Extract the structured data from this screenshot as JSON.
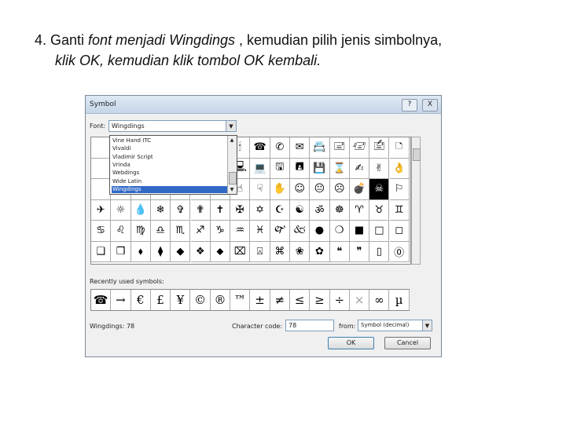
{
  "caption": {
    "line1_prefix": "4. Ganti ",
    "line1_em": "font menjadi Wingdings",
    "line1_suffix": " , kemudian pilih jenis simbolnya,",
    "line2": "klik OK, kemudian klik tombol OK kembali."
  },
  "dialog": {
    "title": "Symbol",
    "help_label": "?",
    "close_label": "X",
    "font_label": "Font:",
    "font_value": "Wingdings",
    "font_list": [
      "Vine Hand ITC",
      "Vivaldi",
      "Vladimir Script",
      "Vrinda",
      "Webdings",
      "Wide Latin",
      "Wingdings"
    ],
    "font_selected_index": 6,
    "symbol_rows": [
      [
        "",
        "",
        "✂",
        "✁",
        "👓",
        "🔔",
        "📖",
        "🕯",
        "☎",
        "✆",
        "✉",
        "📇",
        "🖃",
        "🖅",
        "🖆",
        "🗅"
      ],
      [
        "",
        "",
        "",
        "⏳",
        "⌨",
        "🖱",
        "🖲",
        "🖳",
        "💻",
        "🖫",
        "🖪",
        "💾",
        "⌛",
        "✍",
        "✌",
        "👌"
      ],
      [
        "",
        "",
        "",
        "👍",
        "👎",
        "☜",
        "☞",
        "☝",
        "☟",
        "✋",
        "☺",
        "😐",
        "☹",
        "💣",
        "☠",
        "⚐"
      ],
      [
        "✈",
        "☼",
        "💧",
        "❄",
        "✞",
        "✟",
        "✝",
        "✠",
        "✡",
        "☪",
        "☯",
        "ॐ",
        "☸",
        "♈",
        "♉",
        "♊"
      ],
      [
        "♋",
        "♌",
        "♍",
        "♎",
        "♏",
        "♐",
        "♑",
        "♒",
        "♓",
        "🙰",
        "🙵",
        "●",
        "❍",
        "■",
        "□",
        "◻"
      ],
      [
        "❑",
        "❒",
        "⬧",
        "⧫",
        "◆",
        "❖",
        "⬥",
        "⌧",
        "⍓",
        "⌘",
        "❀",
        "✿",
        "❝",
        "❞",
        "▯",
        "⓪"
      ]
    ],
    "selected_symbol": "☠",
    "recent_label": "Recently used symbols:",
    "recent_symbols": [
      "☎",
      "→",
      "€",
      "£",
      "¥",
      "©",
      "®",
      "™",
      "±",
      "≠",
      "≤",
      "≥",
      "÷",
      "×",
      "∞",
      "µ"
    ],
    "status_text": "Wingdings: 78",
    "char_code_label": "Character code:",
    "char_code_value": "78",
    "from_label": "from:",
    "from_value": "Symbol (decimal)",
    "ok_label": "OK",
    "cancel_label": "Cancel"
  }
}
